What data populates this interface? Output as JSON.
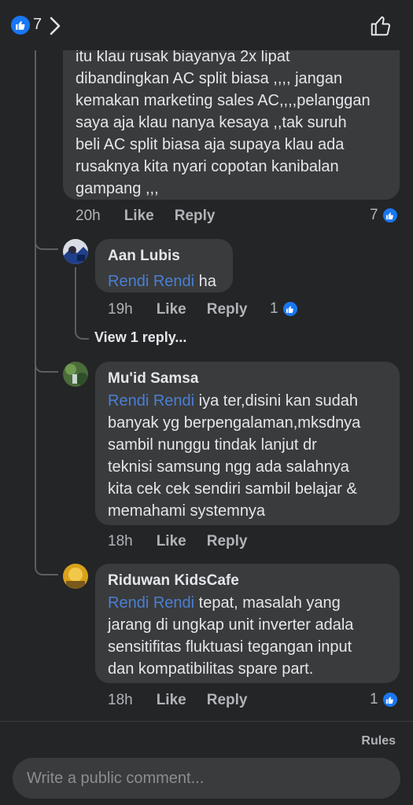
{
  "header": {
    "reaction_count": "7"
  },
  "top_comment": {
    "text": "itu klau rusak biayanya 2x lipat dibandingkan AC split biasa ,,,, jangan kemakan marketing sales AC,,,,pelanggan saya aja klau nanya kesaya ,,tak suruh beli AC split biasa aja supaya klau ada rusaknya kita nyari copotan kanibalan gampang ,,,",
    "lines": [
      "itu klau rusak biayanya 2x lipat",
      "dibandingkan AC split biasa ,,,, jangan",
      "kemakan marketing sales AC,,,,pelanggan",
      "saya aja klau nanya kesaya ,,tak suruh",
      "beli AC split biasa aja supaya klau ada",
      "rusaknya kita nyari copotan kanibalan",
      "gampang ,,,"
    ],
    "time": "20h",
    "like_label": "Like",
    "reply_label": "Reply",
    "reactions": "7"
  },
  "replies": [
    {
      "author": "Aan Lubis",
      "mention": "Rendi Rendi",
      "lines": [
        "ha"
      ],
      "time": "19h",
      "like_label": "Like",
      "reply_label": "Reply",
      "reactions": "1",
      "view_replies": "View 1 reply..."
    },
    {
      "author": "Mu'id Samsa",
      "mention": "Rendi Rendi",
      "lines": [
        "iya ter,disini kan sudah",
        "banyak yg berpengalaman,mksdnya",
        "sambil nunggu tindak lanjut dr",
        "teknisi samsung ngg ada salahnya",
        "kita cek cek sendiri sambil belajar &",
        "memahami systemnya"
      ],
      "time": "18h",
      "like_label": "Like",
      "reply_label": "Reply"
    },
    {
      "author": "Riduwan KidsCafe",
      "mention": "Rendi Rendi",
      "lines": [
        "tepat, masalah yang",
        "jarang di ungkap unit inverter adala",
        "sensitifitas fluktuasi tegangan input",
        "dan kompatibilitas spare part."
      ],
      "time": "18h",
      "like_label": "Like",
      "reply_label": "Reply",
      "reactions": "1"
    }
  ],
  "footer": {
    "rules_label": "Rules",
    "input_placeholder": "Write a public comment..."
  },
  "colors": {
    "background": "#242526",
    "bubble": "#3a3b3c",
    "mention": "#4a7fd4",
    "like_blue": "#1877f2"
  }
}
